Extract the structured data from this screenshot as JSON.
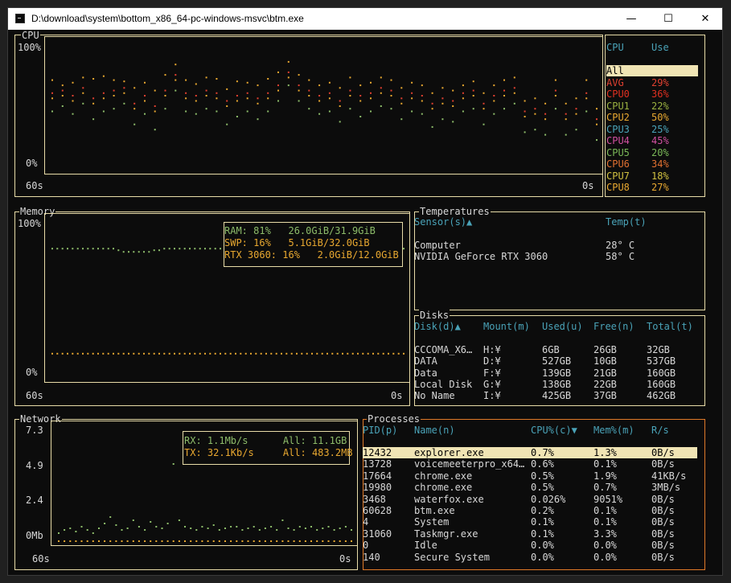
{
  "window": {
    "title": "D:\\download\\system\\bottom_x86_64-pc-windows-msvc\\btm.exe",
    "min": "—",
    "max": "☐",
    "close": "✕"
  },
  "colors": {
    "border": "#e8dca8",
    "accent": "#4aa3b8",
    "orange": "#e07a28",
    "green": "#8dbc6a"
  },
  "cpu": {
    "title": "CPU",
    "y_top": "100%",
    "y_bottom": "0%",
    "x_left": "60s",
    "x_right": "0s",
    "legend_header": {
      "cpu": "CPU",
      "use": "Use"
    },
    "entries": [
      {
        "name": "All",
        "use": "",
        "color": "#000000"
      },
      {
        "name": "AVG",
        "use": "29%",
        "color": "#e04030"
      },
      {
        "name": "CPU0",
        "use": "36%",
        "color": "#e03020"
      },
      {
        "name": "CPU1",
        "use": "22%",
        "color": "#9ab040"
      },
      {
        "name": "CPU2",
        "use": "50%",
        "color": "#e8a830"
      },
      {
        "name": "CPU3",
        "use": "25%",
        "color": "#4aa3b8"
      },
      {
        "name": "CPU4",
        "use": "45%",
        "color": "#d050a0"
      },
      {
        "name": "CPU5",
        "use": "20%",
        "color": "#7ab858"
      },
      {
        "name": "CPU6",
        "use": "34%",
        "color": "#e07030"
      },
      {
        "name": "CPU7",
        "use": "18%",
        "color": "#d0c040"
      },
      {
        "name": "CPU8",
        "use": "27%",
        "color": "#e8a830"
      }
    ]
  },
  "chart_data": [
    {
      "type": "scatter",
      "title": "CPU",
      "x": [
        60,
        58,
        56,
        54,
        52,
        50,
        48,
        46,
        44,
        42,
        40,
        38,
        36,
        34,
        32,
        30,
        28,
        26,
        24,
        22,
        20,
        18,
        16,
        14,
        12,
        10,
        8,
        6,
        4,
        2,
        0
      ],
      "series": [
        {
          "name": "CPU2",
          "color": "#e8a830",
          "values": [
            70,
            66,
            68,
            72,
            71,
            73,
            70,
            69,
            64,
            68,
            62,
            74,
            82,
            70,
            67,
            72,
            71,
            63,
            69,
            68,
            66,
            71,
            76,
            84,
            74,
            70,
            66,
            68,
            64,
            72,
            66,
            68,
            72,
            70,
            64,
            68,
            66,
            60,
            64,
            62,
            66,
            69,
            60,
            66,
            70,
            72,
            54,
            56,
            52,
            70,
            52,
            56,
            70,
            48
          ]
        },
        {
          "name": "AVG",
          "values": [
            60,
            62,
            58,
            64,
            56,
            60,
            62,
            64,
            52,
            58,
            50,
            62,
            74,
            60,
            58,
            62,
            60,
            54,
            58,
            60,
            56,
            60,
            66,
            76,
            66,
            62,
            58,
            60,
            54,
            62,
            58,
            60,
            64,
            62,
            56,
            60,
            58,
            52,
            56,
            54,
            60,
            62,
            52,
            58,
            62,
            64,
            46,
            48,
            44,
            62,
            44,
            48,
            60,
            40
          ]
        },
        {
          "name": "CPU0",
          "values": [
            56,
            58,
            54,
            60,
            52,
            56,
            58,
            60,
            48,
            54,
            46,
            58,
            70,
            56,
            54,
            58,
            56,
            50,
            54,
            56,
            52,
            56,
            62,
            72,
            62,
            58,
            54,
            56,
            50,
            58,
            54,
            56,
            60,
            58,
            52,
            56,
            54,
            48,
            52,
            50,
            56,
            58,
            48,
            54,
            58,
            60,
            42,
            44,
            40,
            58,
            40,
            44,
            56,
            36
          ]
        },
        {
          "name": "CPU1",
          "values": [
            46,
            50,
            44,
            52,
            40,
            46,
            48,
            52,
            36,
            44,
            32,
            48,
            62,
            46,
            44,
            48,
            46,
            36,
            42,
            46,
            40,
            46,
            54,
            66,
            54,
            48,
            44,
            46,
            38,
            48,
            42,
            46,
            50,
            48,
            40,
            46,
            44,
            34,
            40,
            38,
            46,
            48,
            36,
            44,
            48,
            52,
            30,
            32,
            28,
            48,
            28,
            32,
            46,
            24
          ]
        }
      ],
      "xlabel": "",
      "ylabel": "",
      "ylim": [
        0,
        100
      ]
    },
    {
      "type": "scatter",
      "title": "Memory",
      "series": [
        {
          "name": "RAM",
          "values": [
            81,
            81,
            81,
            81,
            81,
            81,
            81,
            81,
            81,
            81,
            81,
            81,
            81,
            80,
            79,
            79,
            79,
            79,
            79,
            79,
            80,
            80,
            81,
            81,
            81,
            81,
            81,
            81,
            81,
            81,
            81,
            81,
            81,
            81,
            81,
            81,
            81,
            81,
            81,
            81,
            81,
            81,
            81,
            81,
            81,
            81,
            81,
            81,
            81,
            81,
            81,
            81,
            81,
            81,
            81,
            81,
            81,
            81,
            81,
            81,
            81,
            81,
            81,
            81,
            81,
            81,
            81,
            81,
            81,
            81
          ]
        },
        {
          "name": "RTX 3060",
          "values": [
            16,
            16,
            16,
            16,
            16,
            16,
            16,
            16,
            16,
            16,
            16,
            16,
            16,
            16,
            16,
            16,
            16,
            16,
            16,
            16,
            16,
            16,
            16,
            16,
            16,
            16,
            16,
            16,
            16,
            16,
            16,
            16,
            16,
            16,
            16,
            16,
            16,
            16,
            16,
            16,
            16,
            16,
            16,
            16,
            16,
            16,
            16,
            16,
            16,
            16,
            16,
            16,
            16,
            16,
            16,
            16,
            16,
            16,
            16,
            16,
            16,
            16,
            16,
            16,
            16,
            16,
            16,
            16,
            16,
            16
          ]
        }
      ],
      "ylim": [
        0,
        100
      ]
    },
    {
      "type": "scatter",
      "title": "Network",
      "series": [
        {
          "name": "RX",
          "values": [
            0.6,
            0.8,
            0.9,
            0.7,
            1.0,
            0.8,
            0.6,
            0.9,
            1.2,
            1.6,
            1.1,
            0.8,
            0.9,
            1.4,
            1.0,
            0.8,
            1.3,
            1.0,
            0.9,
            1.2,
            4.9,
            1.4,
            1.0,
            0.9,
            0.8,
            1.0,
            0.9,
            1.1,
            0.8,
            0.9,
            1.0,
            1.0,
            0.8,
            0.9,
            1.0,
            0.8,
            0.9,
            1.0,
            0.8,
            1.4,
            0.9,
            0.8,
            1.0,
            0.9,
            1.0,
            0.8,
            0.9,
            1.0,
            0.8,
            0.9,
            1.0,
            0.8
          ]
        },
        {
          "name": "TX",
          "values": [
            0.1,
            0.1,
            0.1,
            0.1,
            0.1,
            0.1,
            0.1,
            0.1,
            0.1,
            0.1,
            0.1,
            0.1,
            0.1,
            0.1,
            0.1,
            0.1,
            0.1,
            0.1,
            0.1,
            0.1,
            0.1,
            0.1,
            0.1,
            0.1,
            0.1,
            0.1,
            0.1,
            0.1,
            0.1,
            0.1,
            0.1,
            0.1,
            0.1,
            0.1,
            0.1,
            0.1,
            0.1,
            0.1,
            0.1,
            0.1,
            0.1,
            0.1,
            0.1,
            0.1,
            0.1,
            0.1,
            0.1,
            0.1,
            0.1,
            0.1,
            0.1,
            0.1
          ]
        }
      ],
      "ylim": [
        0,
        7.3
      ]
    }
  ],
  "memory": {
    "title": "Memory",
    "y_top": "100%",
    "y_bottom": "0%",
    "x_left": "60s",
    "x_right": "0s",
    "legend": [
      {
        "text": "RAM: 81%   26.0GiB/31.9GiB",
        "color": "#8dbc6a"
      },
      {
        "text": "SWP: 16%   5.1GiB/32.0GiB",
        "color": "#e8a830"
      },
      {
        "text": "RTX 3060: 16%   2.0GiB/12.0GiB",
        "color": "#e8a830"
      }
    ]
  },
  "temps": {
    "title": "Temperatures",
    "header": {
      "sensor": "Sensor(s)▲",
      "temp": "Temp(t)"
    },
    "rows": [
      {
        "name": "Computer",
        "temp": "28° C"
      },
      {
        "name": "NVIDIA GeForce RTX 3060",
        "temp": "58° C"
      }
    ]
  },
  "disks": {
    "title": "Disks",
    "header": {
      "disk": "Disk(d)▲",
      "mount": "Mount(m)",
      "used": "Used(u)",
      "free": "Free(n)",
      "total": "Total(t)"
    },
    "rows": [
      {
        "disk": "CCCOMA_X6…",
        "mount": "H:¥",
        "used": "6GB",
        "free": "26GB",
        "total": "32GB"
      },
      {
        "disk": "DATA",
        "mount": "D:¥",
        "used": "527GB",
        "free": "10GB",
        "total": "537GB"
      },
      {
        "disk": "Data",
        "mount": "F:¥",
        "used": "139GB",
        "free": "21GB",
        "total": "160GB"
      },
      {
        "disk": "Local Disk",
        "mount": "G:¥",
        "used": "138GB",
        "free": "22GB",
        "total": "160GB"
      },
      {
        "disk": "No Name",
        "mount": "I:¥",
        "used": "425GB",
        "free": "37GB",
        "total": "462GB"
      }
    ]
  },
  "network": {
    "title": "Network",
    "y_labels": [
      "7.3",
      "4.9",
      "2.4",
      "0Mb"
    ],
    "x_left": "60s",
    "x_right": "0s",
    "legend": [
      {
        "text": "RX: 1.1Mb/s      All: 11.1GB",
        "color": "#8dbc6a"
      },
      {
        "text": "TX: 32.1Kb/s     All: 483.2MB",
        "color": "#e8a830"
      }
    ]
  },
  "processes": {
    "title": "Processes",
    "header": {
      "pid": "PID(p)",
      "name": "Name(n)",
      "cpu": "CPU%(c)▼",
      "mem": "Mem%(m)",
      "rs": "R/s"
    },
    "rows": [
      {
        "pid": "12432",
        "name": "explorer.exe",
        "cpu": "0.7%",
        "mem": "1.3%",
        "rs": "0B/s"
      },
      {
        "pid": "13728",
        "name": "voicemeeterpro_x64…",
        "cpu": "0.6%",
        "mem": "0.1%",
        "rs": "0B/s"
      },
      {
        "pid": "17664",
        "name": "chrome.exe",
        "cpu": "0.5%",
        "mem": "1.9%",
        "rs": "41KB/s"
      },
      {
        "pid": "19980",
        "name": "chrome.exe",
        "cpu": "0.5%",
        "mem": "0.7%",
        "rs": "3MB/s"
      },
      {
        "pid": "3468",
        "name": "waterfox.exe",
        "cpu": "0.026%",
        "mem": "9051%",
        "rs": "0B/s"
      },
      {
        "pid": "60628",
        "name": "btm.exe",
        "cpu": "0.2%",
        "mem": "0.1%",
        "rs": "0B/s"
      },
      {
        "pid": "4",
        "name": "System",
        "cpu": "0.1%",
        "mem": "0.1%",
        "rs": "0B/s"
      },
      {
        "pid": "31060",
        "name": "Taskmgr.exe",
        "cpu": "0.1%",
        "mem": "3.3%",
        "rs": "0B/s"
      },
      {
        "pid": "0",
        "name": "Idle",
        "cpu": "0.0%",
        "mem": "0.0%",
        "rs": "0B/s"
      },
      {
        "pid": "140",
        "name": "Secure System",
        "cpu": "0.0%",
        "mem": "0.0%",
        "rs": "0B/s"
      }
    ]
  }
}
